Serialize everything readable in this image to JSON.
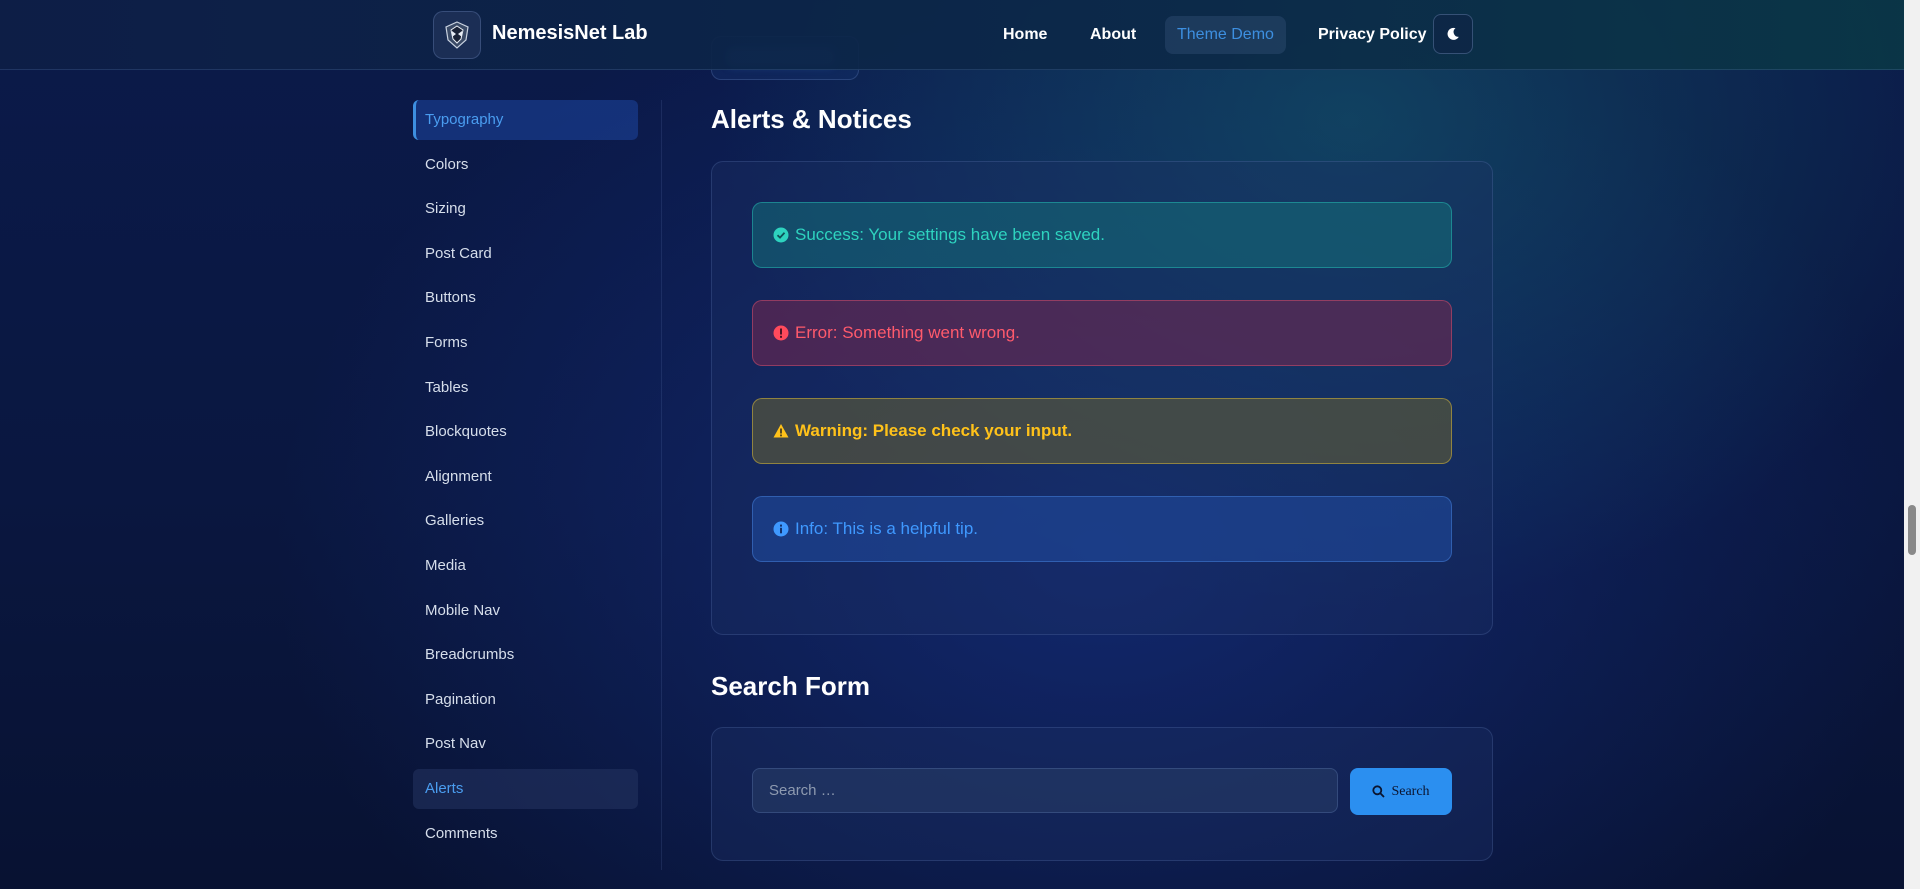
{
  "header": {
    "brand": "NemesisNet Lab",
    "logo_icon": "shield-logo-icon",
    "nav": [
      {
        "label": "Home",
        "active": false
      },
      {
        "label": "About",
        "active": false
      },
      {
        "label": "Theme Demo",
        "active": true
      },
      {
        "label": "Privacy Policy",
        "active": false
      }
    ],
    "theme_toggle_icon": "moon-icon"
  },
  "sidebar": {
    "items": [
      {
        "label": "Typography",
        "state": "active"
      },
      {
        "label": "Colors",
        "state": ""
      },
      {
        "label": "Sizing",
        "state": ""
      },
      {
        "label": "Post Card",
        "state": ""
      },
      {
        "label": "Buttons",
        "state": ""
      },
      {
        "label": "Forms",
        "state": ""
      },
      {
        "label": "Tables",
        "state": ""
      },
      {
        "label": "Blockquotes",
        "state": ""
      },
      {
        "label": "Alignment",
        "state": ""
      },
      {
        "label": "Galleries",
        "state": ""
      },
      {
        "label": "Media",
        "state": ""
      },
      {
        "label": "Mobile Nav",
        "state": ""
      },
      {
        "label": "Breadcrumbs",
        "state": ""
      },
      {
        "label": "Pagination",
        "state": ""
      },
      {
        "label": "Post Nav",
        "state": ""
      },
      {
        "label": "Alerts",
        "state": "highlight"
      },
      {
        "label": "Comments",
        "state": ""
      }
    ]
  },
  "alerts_section": {
    "title": "Alerts & Notices",
    "alerts": {
      "success": {
        "text": "Success: Your settings have been saved.",
        "icon": "check-circle-icon"
      },
      "error": {
        "text": "Error: Something went wrong.",
        "icon": "exclamation-circle-icon"
      },
      "warning": {
        "text": "Warning: Please check your input.",
        "icon": "warning-triangle-icon"
      },
      "info": {
        "text": "Info: This is a helpful tip.",
        "icon": "info-circle-icon"
      }
    }
  },
  "search_section": {
    "title": "Search Form",
    "placeholder": "Search …",
    "button_label": "Search",
    "button_icon": "search-icon"
  },
  "colors": {
    "accent": "#3d8fe0",
    "success": "#2ed3bf",
    "error": "#ff5a6c",
    "warning": "#ffc21a",
    "info": "#3f99ff"
  }
}
